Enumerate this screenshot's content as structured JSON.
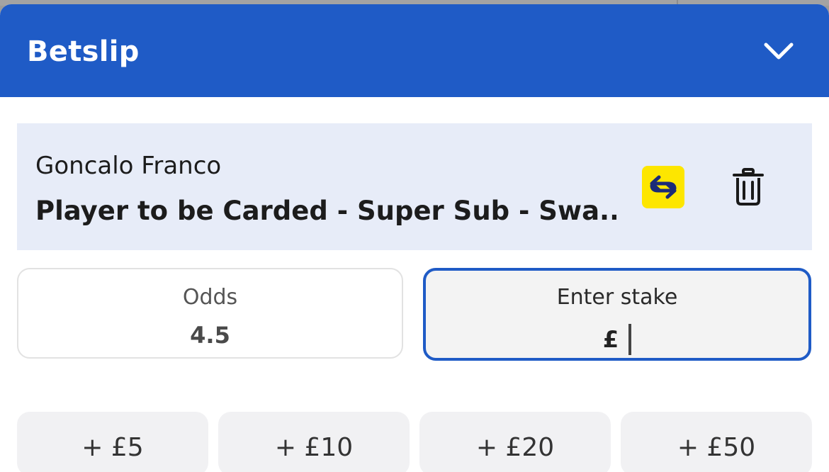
{
  "header": {
    "title": "Betslip",
    "collapse_icon": "chevron-down-icon"
  },
  "selection": {
    "player": "Goncalo Franco",
    "market": "Player to be Carded - Super Sub - Swa...",
    "swap_icon": "swap-arrows-icon",
    "delete_icon": "trash-icon"
  },
  "odds": {
    "label": "Odds",
    "value": "4.5"
  },
  "stake": {
    "label": "Enter stake",
    "currency": "£",
    "value": ""
  },
  "quick_stakes": [
    "+ £5",
    "+ £10",
    "+ £20",
    "+ £50"
  ],
  "colors": {
    "brand_blue": "#1f5bc6",
    "swap_yellow": "#fde600",
    "card_bg": "#e7ecf8"
  }
}
